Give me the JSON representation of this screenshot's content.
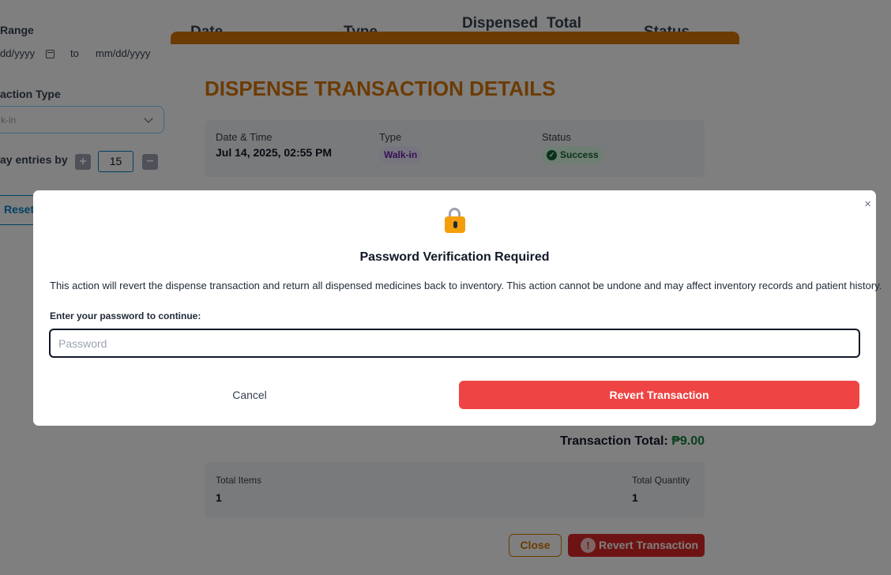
{
  "filters": {
    "date_range_label": "Range",
    "date_from_placeholder": "dd/yyyy",
    "date_separator": "to",
    "date_to_placeholder": "mm/dd/yyyy",
    "transaction_type_label": "action Type",
    "transaction_type_value": "k-in",
    "entries_label": "ay entries by",
    "entries_value": "15",
    "plus_label": "+",
    "minus_label": "−",
    "reset_label": "Reset"
  },
  "table_headers": {
    "date": "Date",
    "type": "Type",
    "dispensed": "Dispensed",
    "total": "Total",
    "status": "Status"
  },
  "details": {
    "title": "DISPENSE TRANSACTION DETAILS",
    "datetime_label": "Date & Time",
    "datetime_value": "Jul 14, 2025, 02:55 PM",
    "type_label": "Type",
    "type_value": "Walk-in",
    "status_label": "Status",
    "status_value": "Success",
    "transaction_total_label": "Transaction Total:",
    "transaction_total_value": "₱9.00",
    "total_items_label": "Total Items",
    "total_items_value": "1",
    "total_quantity_label": "Total Quantity",
    "total_quantity_value": "1",
    "close_label": "Close",
    "revert_label": "Revert Transaction"
  },
  "password_modal": {
    "close_symbol": "×",
    "title": "Password Verification Required",
    "description": "This action will revert the dispense transaction and return all dispensed medicines back to inventory. This action cannot be undone and may affect inventory records and patient history.",
    "input_label": "Enter your password to continue:",
    "input_placeholder": "Password",
    "input_value": "",
    "cancel_label": "Cancel",
    "revert_label": "Revert Transaction"
  },
  "colors": {
    "accent": "#d97706",
    "danger": "#ef4444",
    "success": "#15803d",
    "link": "#0284c7"
  }
}
